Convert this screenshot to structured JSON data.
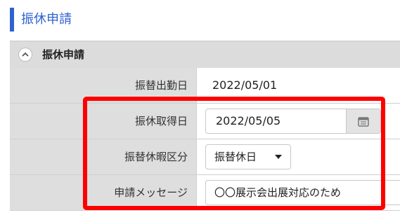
{
  "page": {
    "title": "振休申請"
  },
  "section": {
    "label": "振休申請",
    "toggle_icon": "chevron-up-icon"
  },
  "form": {
    "work_date": {
      "label": "振替出勤日",
      "value": "2022/05/01"
    },
    "leave_date": {
      "label": "振休取得日",
      "value": "2022/05/05",
      "icon": "calendar-icon"
    },
    "leave_type": {
      "label": "振替休暇区分",
      "selected": "振替休日",
      "icon": "caret-down-icon"
    },
    "message": {
      "label": "申請メッセージ",
      "value": "〇〇展示会出展対応のため"
    }
  },
  "colors": {
    "accent": "#2f62d1",
    "highlight": "#ff0000",
    "label_bg": "#dedede"
  }
}
